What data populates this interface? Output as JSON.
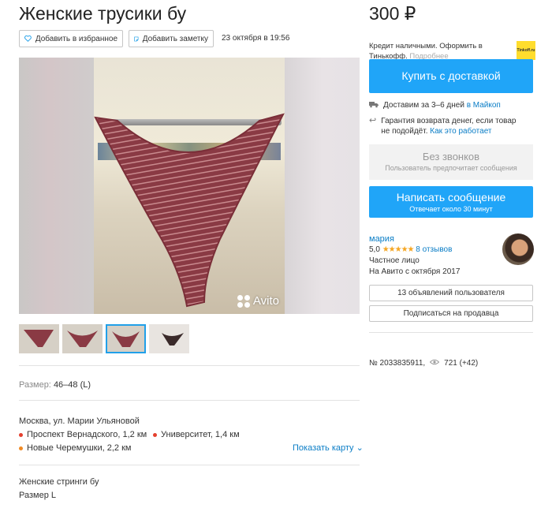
{
  "listing": {
    "title": "Женские трусики бу",
    "price": "300 ₽",
    "posted": "23 октября в 19:56",
    "watermark": "Avito"
  },
  "actions": {
    "favorite_label": "Добавить в избранное",
    "note_label": "Добавить заметку"
  },
  "params": {
    "size_label": "Размер:",
    "size_value": "46–48 (L)"
  },
  "location": {
    "address": "Москва, ул. Марии Ульяновой",
    "metro": [
      {
        "name": "Проспект Вернадского, 1,2 км",
        "color": "#e4402e"
      },
      {
        "name": "Университет, 1,4 км",
        "color": "#e4402e"
      },
      {
        "name": "Новые Черемушки, 2,2 км",
        "color": "#f08a24"
      }
    ],
    "show_map": "Показать карту"
  },
  "description": {
    "line1": "Женские стринги бу",
    "line2": "Размер L"
  },
  "sidebar": {
    "credit_text": "Кредит наличными. Оформить в Тинькофф.",
    "credit_more": "Подробнее",
    "tinkoff_logo": "Tinkoff.ru",
    "buy_button": "Купить с доставкой",
    "delivery_text": "Доставим за 3–6 дней",
    "delivery_link": "в Майкоп",
    "refund_text": "Гарантия возврата денег, если товар не подойдёт.",
    "refund_link": "Как это работает",
    "nocall_title": "Без звонков",
    "nocall_sub": "Пользователь предпочитает сообщения",
    "message_button": "Написать сообщение",
    "message_sub": "Отвечает около 30 минут",
    "seller_name": "мария",
    "seller_rating": "5,0",
    "seller_stars": "★★★★★",
    "seller_reviews": "8 отзывов",
    "seller_type": "Частное лицо",
    "seller_since": "На Авито с октября 2017",
    "ads_button": "13 объявлений пользователя",
    "subscribe_button": "Подписаться на продавца",
    "ad_number": "№ 2033835911,",
    "views": "721 (+42)"
  },
  "colors": {
    "accent": "#20a5f8",
    "link": "#0a7dc6",
    "thumb_active": "#21a0e9"
  }
}
